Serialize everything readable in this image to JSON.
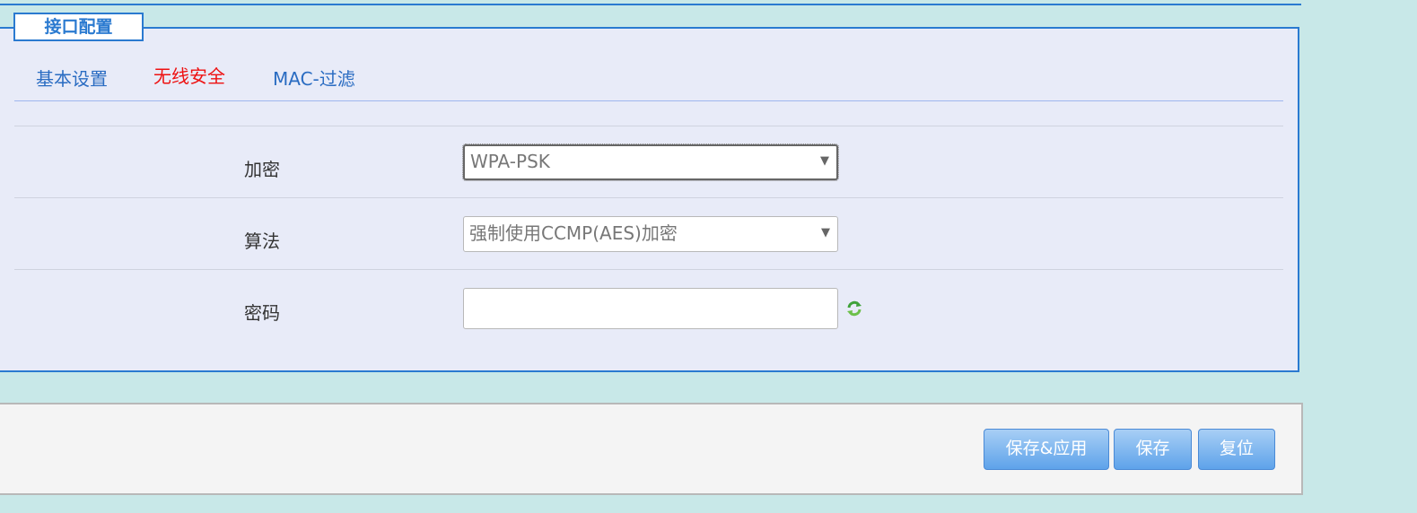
{
  "legend": "接口配置",
  "tabs": [
    {
      "label": "基本设置",
      "active": false
    },
    {
      "label": "无线安全",
      "active": true
    },
    {
      "label": "MAC-过滤",
      "active": false
    }
  ],
  "fields": {
    "encryption": {
      "label": "加密",
      "value": "WPA-PSK"
    },
    "algorithm": {
      "label": "算法",
      "value": "强制使用CCMP(AES)加密"
    },
    "password": {
      "label": "密码",
      "value": ""
    }
  },
  "icons": {
    "dropdown_arrow": "▼",
    "refresh": "refresh-icon"
  },
  "buttons": {
    "save_apply": "保存&应用",
    "save": "保存",
    "reset": "复位"
  },
  "colors": {
    "accent": "#2a7ad0",
    "active_tab": "#ee1111",
    "tab": "#2a6cc2",
    "button": "#5ea3ea"
  }
}
